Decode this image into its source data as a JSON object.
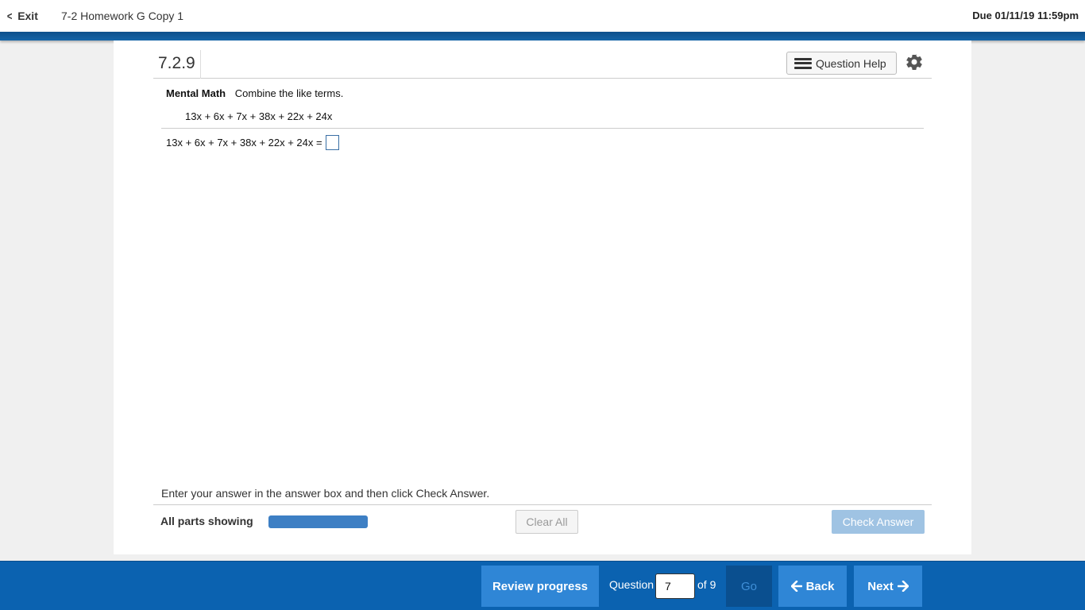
{
  "header": {
    "exit_label": "Exit",
    "assignment_title": "7-2 Homework G Copy 1",
    "due": "Due 01/11/19 11:59pm"
  },
  "question": {
    "number": "7.2.9",
    "help_label": "Question Help",
    "heading": "Mental Math",
    "instruction": "Combine the like terms.",
    "expression": "13x + 6x + 7x + 38x + 22x + 24x",
    "answer_prefix": "13x + 6x + 7x + 38x + 22x + 24x =",
    "answer_value": ""
  },
  "footer": {
    "enter_text": "Enter your answer in the answer box and then click Check Answer.",
    "parts_label": "All parts showing",
    "progress_fraction": 1.0,
    "clear_label": "Clear All",
    "check_label": "Check Answer"
  },
  "nav": {
    "review_label": "Review progress",
    "question_label": "Question",
    "question_value": "7",
    "of_label": "of 9",
    "go_label": "Go",
    "back_label": "Back",
    "next_label": "Next"
  },
  "icons": {
    "exit": "chevron-left-icon",
    "help": "list-icon",
    "settings": "gear-icon",
    "back": "arrow-left-icon",
    "next": "arrow-right-icon"
  },
  "colors": {
    "brand_blue": "#0b62b0",
    "button_blue": "#2f86d6",
    "progress_blue": "#3d7fc4"
  }
}
